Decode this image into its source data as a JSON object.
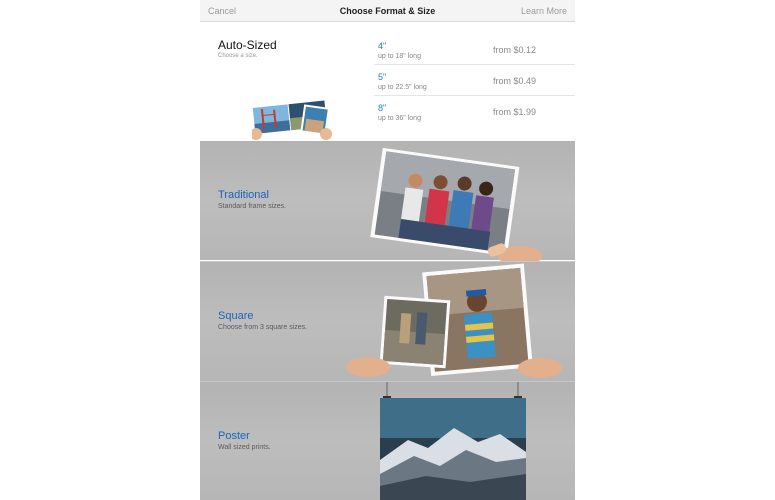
{
  "nav": {
    "cancel": "Cancel",
    "title": "Choose Format & Size",
    "learn_more": "Learn More"
  },
  "auto_sized": {
    "title": "Auto-Sized",
    "subtitle": "Choose a size.",
    "sizes": [
      {
        "inch": "4\"",
        "length": "up to 18\" long",
        "price": "from $0.12"
      },
      {
        "inch": "5\"",
        "length": "up to 22.5\" long",
        "price": "from $0.49"
      },
      {
        "inch": "8\"",
        "length": "up to 36\" long",
        "price": "from $1.99"
      }
    ]
  },
  "formats": [
    {
      "title": "Traditional",
      "subtitle": "Standard frame sizes."
    },
    {
      "title": "Square",
      "subtitle": "Choose from 3 square sizes."
    },
    {
      "title": "Poster",
      "subtitle": "Wall sized prints."
    }
  ],
  "colors": {
    "accent": "#1f7ad6",
    "format_title": "#1d63b8",
    "section_gray": "#b8b8b8"
  }
}
